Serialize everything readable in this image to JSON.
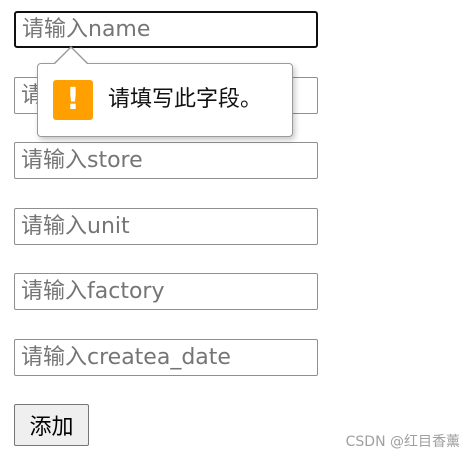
{
  "form": {
    "fields": [
      {
        "placeholder": "请输入name",
        "value": ""
      },
      {
        "placeholder": "请输入",
        "value": ""
      },
      {
        "placeholder": "请输入store",
        "value": ""
      },
      {
        "placeholder": "请输入unit",
        "value": ""
      },
      {
        "placeholder": "请输入factory",
        "value": ""
      },
      {
        "placeholder": "请输入createa_date",
        "value": ""
      }
    ],
    "submit_label": "添加"
  },
  "validation_tooltip": {
    "icon": "warning-exclamation-icon",
    "icon_glyph": "!",
    "icon_color": "#ffa000",
    "message": "请填写此字段。"
  },
  "watermark": "CSDN @红目香薰"
}
